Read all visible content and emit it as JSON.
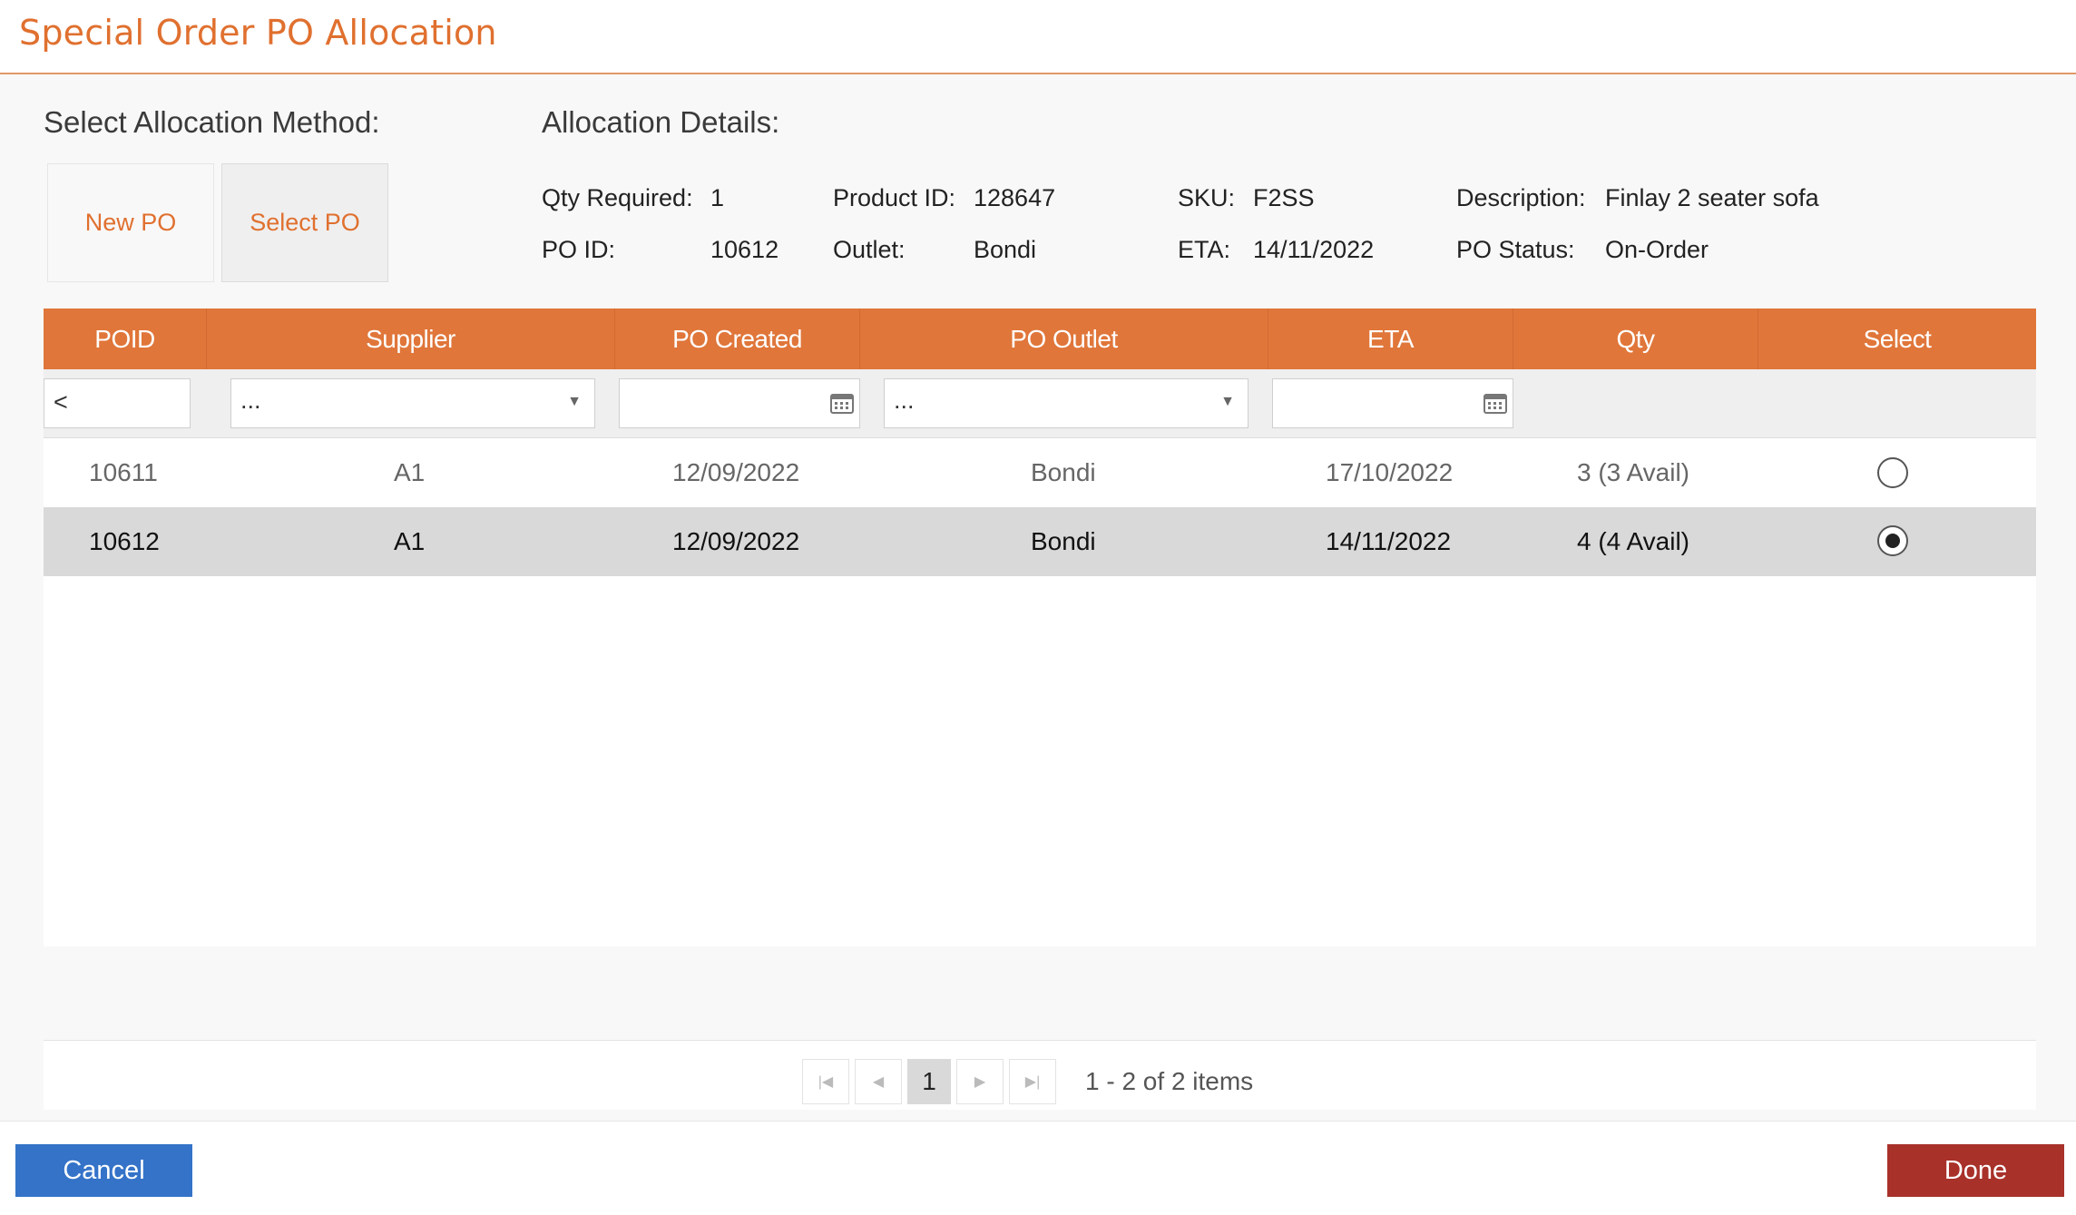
{
  "window": {
    "title": "Special Order PO Allocation"
  },
  "method": {
    "label": "Select Allocation Method:",
    "new_po": "New PO",
    "select_po": "Select PO"
  },
  "details": {
    "label": "Allocation Details:",
    "qty_required_label": "Qty Required:",
    "qty_required": "1",
    "product_id_label": "Product ID:",
    "product_id": "128647",
    "sku_label": "SKU:",
    "sku": "F2SS",
    "description_label": "Description:",
    "description": "Finlay 2 seater sofa",
    "po_id_label": "PO ID:",
    "po_id": "10612",
    "outlet_label": "Outlet:",
    "outlet": "Bondi",
    "eta_label": "ETA:",
    "eta": "14/11/2022",
    "po_status_label": "PO Status:",
    "po_status": "On-Order"
  },
  "grid": {
    "columns": [
      "POID",
      "Supplier",
      "PO Created",
      "PO Outlet",
      "ETA",
      "Qty",
      "Select"
    ],
    "filters": {
      "poid": "<",
      "supplier": "...",
      "po_outlet": "..."
    },
    "rows": [
      {
        "poid": "10611",
        "supplier": "A1",
        "po_created": "12/09/2022",
        "po_outlet": "Bondi",
        "eta": "17/10/2022",
        "qty": "3 (3 Avail)",
        "selected": false
      },
      {
        "poid": "10612",
        "supplier": "A1",
        "po_created": "12/09/2022",
        "po_outlet": "Bondi",
        "eta": "14/11/2022",
        "qty": "4 (4 Avail)",
        "selected": true
      }
    ]
  },
  "pager": {
    "current_page": "1",
    "info": "1 - 2 of 2 items"
  },
  "footer": {
    "cancel": "Cancel",
    "done": "Done"
  },
  "colors": {
    "accent": "#e0763a",
    "cancel": "#3473c8",
    "done": "#a8312a"
  },
  "icons": [
    "calendar-icon",
    "dropdown-arrow-icon",
    "first-page-icon",
    "prev-page-icon",
    "next-page-icon",
    "last-page-icon"
  ]
}
